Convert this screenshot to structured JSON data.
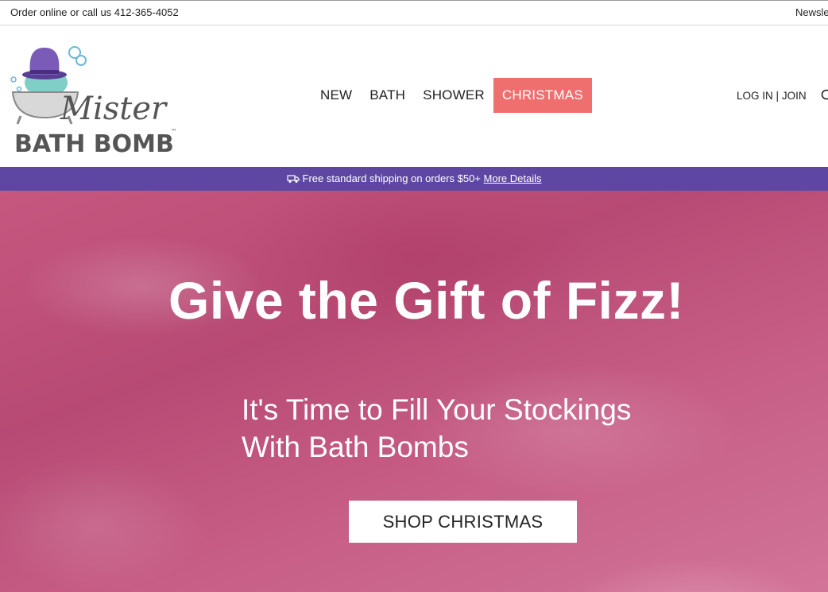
{
  "topbar": {
    "order_text": "Order online or call us 412-365-4052",
    "newsletter_text": "Newsle"
  },
  "logo": {
    "line1": "Mister",
    "line2": "BATH BOMB",
    "tm": "™"
  },
  "nav": {
    "items": [
      {
        "label": "NEW"
      },
      {
        "label": "BATH"
      },
      {
        "label": "SHOWER"
      },
      {
        "label": "CHRISTMAS"
      }
    ]
  },
  "account": {
    "login": "LOG IN",
    "separator": "|",
    "join": "JOIN"
  },
  "shipping": {
    "text": "Free standard shipping on orders $50+",
    "link": "More Details"
  },
  "hero": {
    "title": "Give the Gift of Fizz!",
    "subtitle_line1": "It's Time to Fill Your Stockings",
    "subtitle_line2": "With Bath Bombs",
    "button": "SHOP CHRISTMAS"
  },
  "colors": {
    "nav_active": "#ef6f6f",
    "shipping_bar": "#5e47a2",
    "hero_bg": "#c25a82"
  }
}
